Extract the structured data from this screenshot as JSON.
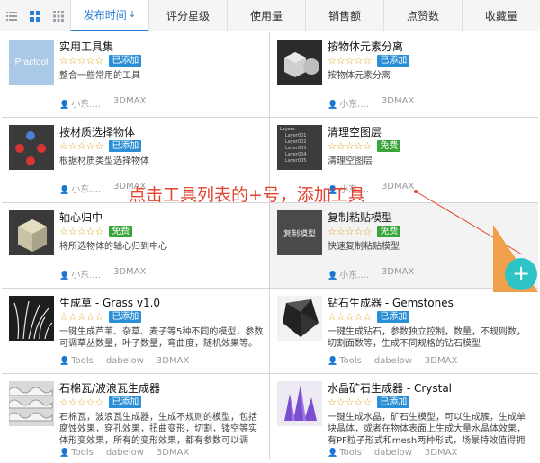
{
  "toolbar": {
    "views": [
      "list-view-icon",
      "grid-view-icon",
      "small-grid-view-icon"
    ],
    "tabs": [
      {
        "label": "发布时间",
        "arrow": "↓",
        "active": true
      },
      {
        "label": "评分星级"
      },
      {
        "label": "使用量"
      },
      {
        "label": "销售额"
      },
      {
        "label": "点赞数"
      },
      {
        "label": "收藏量"
      }
    ]
  },
  "cards": [
    {
      "title": "实用工具集",
      "stars": "☆☆☆☆☆",
      "badge": "已添加",
      "desc": "整合一些常用的工具",
      "author": "小东....",
      "category": "",
      "platform": "3DMAX",
      "thumb_text": "Practool"
    },
    {
      "title": "按物体元素分离",
      "stars": "☆☆☆☆☆",
      "badge": "已添加",
      "desc": "按物体元素分离",
      "author": "小东....",
      "category": "",
      "platform": "3DMAX"
    },
    {
      "title": "按材质选择物体",
      "stars": "☆☆☆☆☆",
      "badge": "已添加",
      "desc": "根据材质类型选择物体",
      "author": "小东....",
      "category": "",
      "platform": "3DMAX"
    },
    {
      "title": "清理空图层",
      "stars": "☆☆☆☆☆",
      "badge": "免费",
      "desc": "清理空图层",
      "author": "小东....",
      "category": "",
      "platform": "3DMAX",
      "thumb_title": "Layers",
      "thumb_layers": [
        "Layer001",
        "Layer002",
        "Layer003",
        "Layer004",
        "Layer005"
      ]
    },
    {
      "title": "轴心归中",
      "stars": "☆☆☆☆☆",
      "badge": "免费",
      "desc": "将所选物体的轴心归到中心",
      "author": "小东....",
      "category": "",
      "platform": "3DMAX"
    },
    {
      "title": "复制粘贴模型",
      "stars": "☆☆☆☆☆",
      "badge": "免费",
      "desc": "快速复制粘贴模型",
      "author": "小东....",
      "category": "",
      "platform": "3DMAX",
      "thumb_text": "复制模型"
    },
    {
      "title": "生成草 - Grass v1.0",
      "stars": "☆☆☆☆☆",
      "badge": "已添加",
      "desc": "一键生成芦苇、杂草、麦子等5种不同的模型，参数可调草丛数量，叶子数量，弯曲度，随机效果等。",
      "author": "Tools",
      "category": "dabelow",
      "platform": "3DMAX"
    },
    {
      "title": "钻石生成器 - Gemstones",
      "stars": "☆☆☆☆☆",
      "badge": "已添加",
      "desc": "一键生成钻石，参数独立控制，数量，不规则数，切割面数等，生成不同规格的钻石模型",
      "author": "Tools",
      "category": "dabelow",
      "platform": "3DMAX"
    },
    {
      "title": "石棉瓦/波浪瓦生成器",
      "stars": "☆☆☆☆☆",
      "badge": "已添加",
      "desc": "石棉瓦，波浪瓦生成器，生成不规则的模型，包括腐蚀效果，穿孔效果，扭曲变形，切割，镂空等实体形变效果，所有的变形效果，都有参数可以调整。简...",
      "author": "Tools",
      "category": "dabelow",
      "platform": "3DMAX"
    },
    {
      "title": "水晶矿石生成器 - Crystal",
      "stars": "☆☆☆☆☆",
      "badge": "已添加",
      "desc": "一键生成水晶，矿石生模型，可以生成簇，生成单块晶体，或者在物体表面上生成大量水晶体效果，有PF粒子形式和mesh两种形式，场景特效值得拥有！",
      "author": "Tools",
      "category": "dabelow",
      "platform": "3DMAX"
    }
  ],
  "overlay": {
    "callout": "点击工具列表的+号，添加工具",
    "plus": "+"
  },
  "colors": {
    "accent": "#2a7fd4",
    "added": "#2a8fd6",
    "free": "#3aa53a",
    "callout": "#e2432e",
    "plus": "#2ec4c6",
    "star": "#e0a21b"
  }
}
